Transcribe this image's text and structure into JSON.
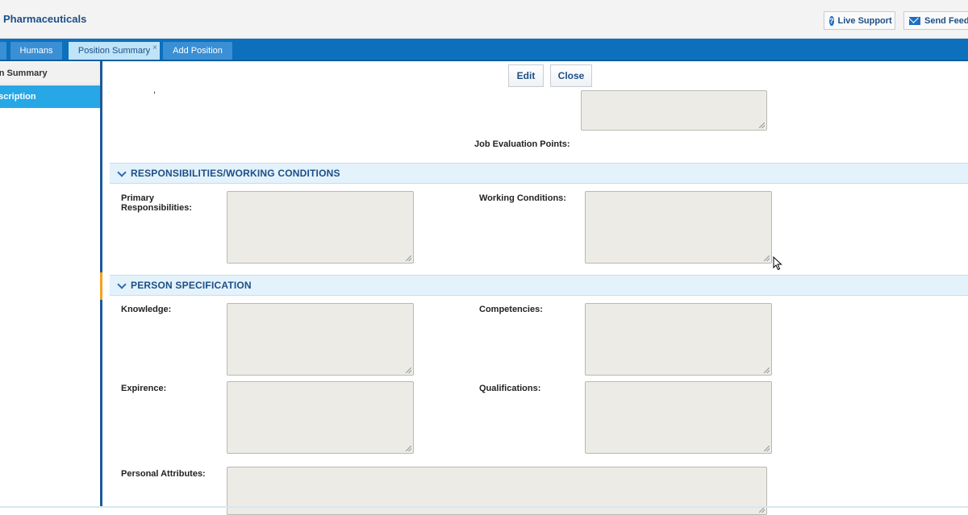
{
  "header": {
    "brand": "Pharmaceuticals",
    "live_support": "Live Support",
    "send_feedback": "Send Feedb",
    "live_support_icon": "question-circle-icon",
    "send_feedback_icon": "envelope-icon"
  },
  "tabs": [
    {
      "label": "Humans"
    },
    {
      "label": "Position Summary",
      "close": "×"
    },
    {
      "label": "Add Position"
    }
  ],
  "sidebar": {
    "items": [
      {
        "label": "on Summary"
      },
      {
        "label": "escription"
      }
    ]
  },
  "actions": {
    "edit": "Edit",
    "close": "Close"
  },
  "top_section": {
    "job_evaluation_points_label": "Job Evaluation Points:"
  },
  "responsibilities": {
    "title": "RESPONSIBILITIES/WORKING CONDITIONS",
    "primary_label": "Primary Responsibilities:",
    "working_conditions_label": "Working Conditions:"
  },
  "person_spec": {
    "title": "PERSON SPECIFICATION",
    "knowledge_label": "Knowledge:",
    "competencies_label": "Competencies:",
    "experience_label": "Expirence:",
    "qualifications_label": "Qualifications:",
    "personal_attributes_label": "Personal Attributes:"
  },
  "colors": {
    "tabbar": "#0c70bd",
    "active_tab": "#bfe3f7",
    "sidebar_active": "#27a7e6",
    "section_header": "#e4f2fb",
    "textarea": "#ecebe6"
  }
}
